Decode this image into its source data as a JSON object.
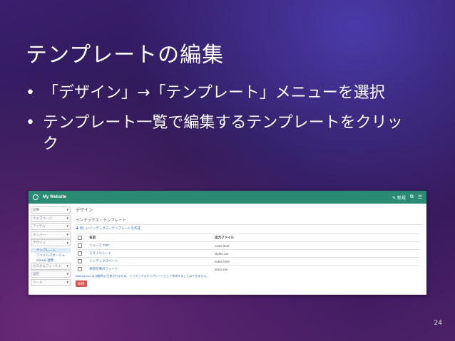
{
  "slide": {
    "title": "テンプレートの編集",
    "bullets": [
      "「デザイン」→「テンプレート」メニューを選択",
      "テンプレート一覧で編集するテンプレートをクリック"
    ],
    "page_number": "24"
  },
  "screenshot": {
    "topbar": {
      "site_name": "My Website",
      "new_label": "✎ 新規"
    },
    "sidebar": {
      "items": [
        {
          "label": "記事"
        },
        {
          "label": "ウェブページ"
        },
        {
          "label": "アイテム"
        },
        {
          "label": "メンバー"
        },
        {
          "label": "デザイン"
        }
      ],
      "sub_items": [
        {
          "label": "テンプレート"
        },
        {
          "label": "ファイルマネージャ"
        },
        {
          "label": "GitHub 連携"
        }
      ],
      "items_after": [
        {
          "label": "カスタムフィールド"
        },
        {
          "label": "設定"
        },
        {
          "label": "ツール"
        }
      ]
    },
    "main": {
      "title": "デザイン",
      "section_title": "インデックス・テンプレート",
      "new_link": "✚ 新しいインデックス・テンプレートを作成",
      "columns": [
        "名前",
        "出力ファイル"
      ],
      "rows": [
        {
          "name": "ニュース TOP",
          "file": "news.html"
        },
        {
          "name": "スタイルシート",
          "file": "styles.css"
        },
        {
          "name": "インデックスページ",
          "file": "index.html"
        },
        {
          "name": "更新記事のフィード",
          "file": "atom.xml"
        }
      ],
      "note": "sitemap.xml は 自動的に生成されるため、インデックステンプレートとして作成することはできません。",
      "action_button": "削除"
    }
  }
}
